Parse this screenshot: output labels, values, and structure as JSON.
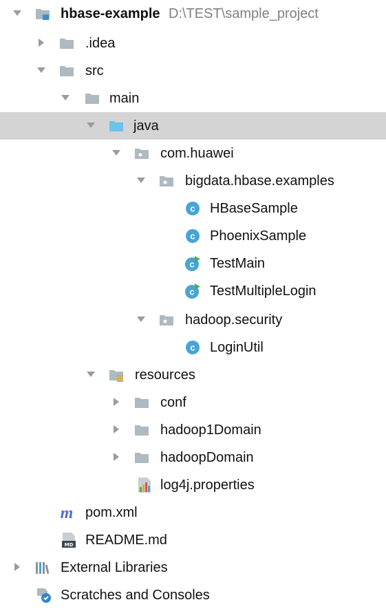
{
  "project_tree": {
    "root": {
      "name": "hbase-example",
      "path": "D:\\TEST\\sample_project"
    },
    "items": [
      {
        "label": ".idea",
        "icon": "folder-icon",
        "expanded": false
      },
      {
        "label": "src",
        "icon": "folder-icon",
        "expanded": true
      },
      {
        "label": "main",
        "icon": "folder-icon",
        "expanded": true
      },
      {
        "label": "java",
        "icon": "source-root-folder-icon",
        "expanded": true,
        "selected": true
      },
      {
        "label": "com.huawei",
        "icon": "package-icon",
        "expanded": true
      },
      {
        "label": "bigdata.hbase.examples",
        "icon": "package-icon",
        "expanded": true
      },
      {
        "label": "HBaseSample",
        "icon": "java-class-icon"
      },
      {
        "label": "PhoenixSample",
        "icon": "java-class-icon"
      },
      {
        "label": "TestMain",
        "icon": "runnable-class-icon"
      },
      {
        "label": "TestMultipleLogin",
        "icon": "runnable-class-icon"
      },
      {
        "label": "hadoop.security",
        "icon": "package-icon",
        "expanded": true
      },
      {
        "label": "LoginUtil",
        "icon": "java-class-icon"
      },
      {
        "label": "resources",
        "icon": "resources-folder-icon",
        "expanded": true
      },
      {
        "label": "conf",
        "icon": "folder-icon",
        "expanded": false
      },
      {
        "label": "hadoop1Domain",
        "icon": "folder-icon",
        "expanded": false
      },
      {
        "label": "hadoopDomain",
        "icon": "folder-icon",
        "expanded": false
      },
      {
        "label": "log4j.properties",
        "icon": "properties-file-icon"
      },
      {
        "label": "pom.xml",
        "icon": "maven-icon"
      },
      {
        "label": "README.md",
        "icon": "markdown-file-icon"
      }
    ],
    "external_libraries": {
      "label": "External Libraries",
      "icon": "libraries-icon",
      "expanded": false
    },
    "scratches": {
      "label": "Scratches and Consoles",
      "icon": "scratches-icon"
    }
  },
  "colors": {
    "selection_background": "#d4d4d4",
    "folder": "#aeb9c0",
    "source_root_folder": "#6cc3e8",
    "class_badge": "#46a5d6",
    "run_marker": "#4cae4c",
    "maven_m": "#4f6fd0",
    "path_text": "#808080"
  }
}
